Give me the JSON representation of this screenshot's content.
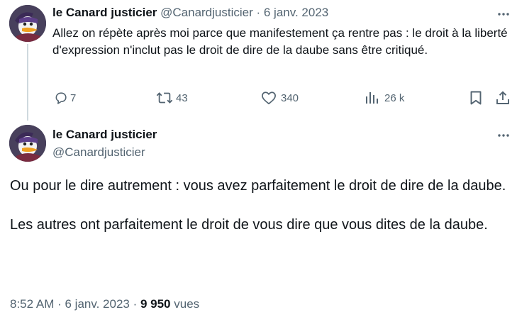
{
  "tweet1": {
    "display_name": "le Canard justicier",
    "handle": "@Canardjusticier",
    "separator": " · ",
    "date": "6 janv. 2023",
    "text": "Allez on répète après moi parce que manifestement ça rentre pas : le droit à la liberté d'expression n'inclut pas le droit de dire de la daube sans être critiqué.",
    "replies": "7",
    "retweets": "43",
    "likes": "340",
    "views": "26 k"
  },
  "tweet2": {
    "display_name": "le Canard justicier",
    "handle": "@Canardjusticier",
    "paragraph1": "Ou pour le dire autrement : vous avez parfaitement le droit de dire de la daube.",
    "paragraph2": "Les autres ont parfaitement le droit de vous dire que vous dites de la daube.",
    "time": "8:52 AM",
    "separator": " · ",
    "date": "6 janv. 2023",
    "separator2": " · ",
    "views_count": "9 950",
    "views_label": " vues"
  },
  "colors": {
    "text": "#0f1419",
    "muted": "#536471",
    "thread_line": "#cfd9de"
  },
  "icons": {
    "more": "more-horizontal-icon",
    "reply": "reply-icon",
    "retweet": "retweet-icon",
    "like": "heart-icon",
    "views": "analytics-icon",
    "bookmark": "bookmark-icon",
    "share": "share-icon"
  }
}
